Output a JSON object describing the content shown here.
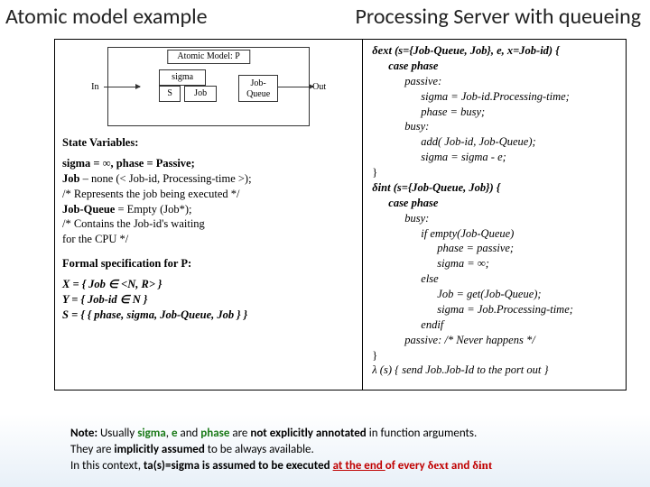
{
  "header": {
    "title_left": "Atomic model example",
    "title_right": "Processing Server with queueing"
  },
  "diagram": {
    "top_label": "Atomic Model: P",
    "in_label": "In",
    "out_label": "Out",
    "sigma": "sigma",
    "s": "S",
    "job": "Job",
    "queue": "Job-Queue"
  },
  "left": {
    "state_head": "State Variables:",
    "sv1": "sigma = ∞, phase = Passive;",
    "sv2a": "Job",
    "sv2b": " – none (< Job-id, Processing-time >);",
    "sv3": "/* Represents the job being executed */",
    "sv4a": "Job-Queue",
    "sv4b": " = Empty (Job*);",
    "sv5": "/* Contains the Job-id's waiting",
    "sv6": "  for the CPU */",
    "formal_head": "Formal specification for P:",
    "f1": "X = { Job ∈ <N, R> }",
    "f2": "Y = { Job-id ∈ N }",
    "f3": "S = { { phase, sigma, Job-Queue, Job } }"
  },
  "right": {
    "dext_sig": "δext (s={Job-Queue, Job}, e, x=Job-id) {",
    "case": "case phase",
    "passive": "passive:",
    "p1": "sigma = Job-id.Processing-time;",
    "p2": "phase = busy;",
    "busy": "busy:",
    "b1": "add( Job-id, Job-Queue);",
    "b2": "sigma = sigma - e;",
    "close1": "}",
    "dint_sig": "δint (s={Job-Queue, Job}) {",
    "ibusy": "busy:",
    "if": "if empty(Job-Queue)",
    "ip1": "phase = passive;",
    "ip2": "sigma = ∞;",
    "else": "else",
    "ie1": "Job = get(Job-Queue);",
    "ie2": "sigma = Job.Processing-time;",
    "endif": "endif",
    "ipassive": "passive:  /* Never happens */",
    "close2": "}",
    "lambda": "λ (s) { send Job.Job-Id to the port out }"
  },
  "note": {
    "pre1": "Note:",
    "t1": " Usually ",
    "sigma": "sigma",
    "t2": ", ",
    "e": "e",
    "t3": " and ",
    "phase": "phase",
    "t4": " are ",
    "b1": "not explicitly annotated",
    "t5": " in function arguments.",
    "line2a": "They are ",
    "b2": "implicitly assumed",
    "line2b": " to be always available.",
    "line3a": "In this context, ",
    "ta": "ta(s)=sigma is assumed to be executed ",
    "end": "at the end ",
    "every": "of every ",
    "dext": "δext",
    "and": " and ",
    "dint": "δint"
  }
}
